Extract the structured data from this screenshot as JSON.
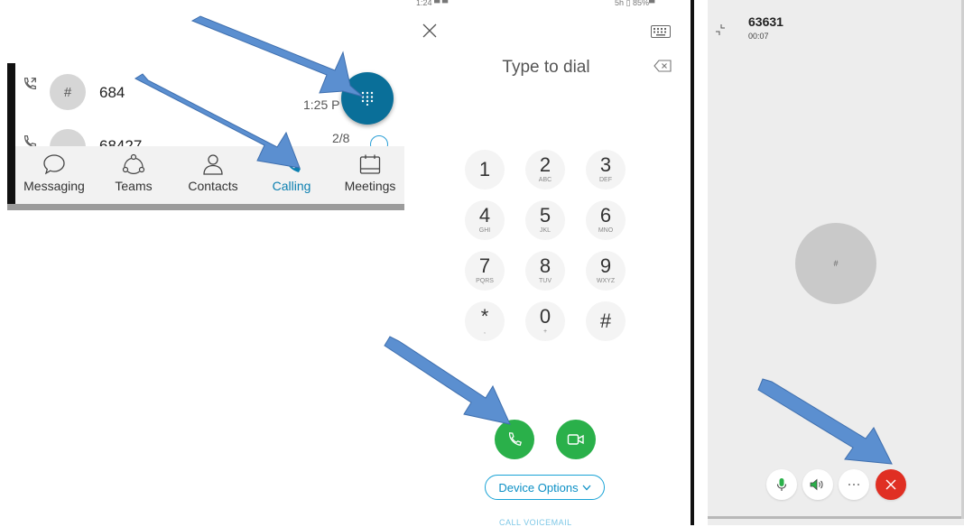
{
  "history": {
    "rows": [
      {
        "avatar_text": "#",
        "name": "684",
        "time": "1:25 P"
      },
      {
        "avatar_text": "#",
        "name": "68427",
        "time": "2/8"
      }
    ]
  },
  "tabbar": {
    "tabs": [
      {
        "label": "Messaging",
        "icon": "chat-bubble-icon"
      },
      {
        "label": "Teams",
        "icon": "teams-icon"
      },
      {
        "label": "Contacts",
        "icon": "person-icon"
      },
      {
        "label": "Calling",
        "icon": "phone-icon",
        "active": true
      },
      {
        "label": "Meetings",
        "icon": "calendar-icon"
      }
    ],
    "active_color": "#0b7fb0"
  },
  "fab": {
    "icon": "dialpad-icon",
    "color": "#0a6f99"
  },
  "annotations": {
    "arrow_5a": "5a",
    "arrow_5": "5",
    "arrow_color": "#5b8fd0"
  },
  "dialer": {
    "status_left": "1:24 ▀ ▀",
    "status_right": "5h ▯ 85%▀",
    "placeholder": "Type to dial",
    "keys": [
      {
        "digit": "1",
        "letters": ""
      },
      {
        "digit": "2",
        "letters": "ABC"
      },
      {
        "digit": "3",
        "letters": "DEF"
      },
      {
        "digit": "4",
        "letters": "GHI"
      },
      {
        "digit": "5",
        "letters": "JKL"
      },
      {
        "digit": "6",
        "letters": "MNO"
      },
      {
        "digit": "7",
        "letters": "PQRS"
      },
      {
        "digit": "8",
        "letters": "TUV"
      },
      {
        "digit": "9",
        "letters": "WXYZ"
      },
      {
        "digit": "*",
        "letters": ","
      },
      {
        "digit": "0",
        "letters": "+"
      },
      {
        "digit": "#",
        "letters": ""
      }
    ],
    "device_options": "Device Options",
    "voicemail": "CALL VOICEMAIL",
    "call_color": "#2ab04a"
  },
  "active_call": {
    "number": "63631",
    "timer": "00:07",
    "avatar_text": "#",
    "end_color": "#e02f23"
  }
}
